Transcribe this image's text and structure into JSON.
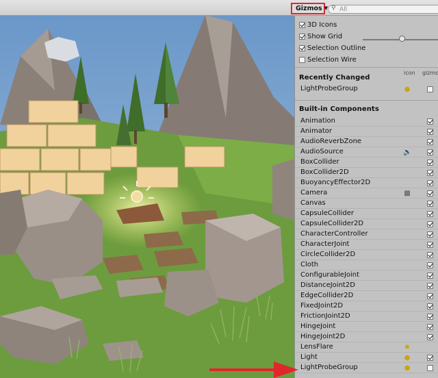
{
  "toolbar": {
    "gizmos_label": "Gizmos",
    "search_placeholder": "All"
  },
  "gizmo_options": [
    {
      "label": "3D Icons",
      "checked": true
    },
    {
      "label": "Show Grid",
      "checked": true
    },
    {
      "label": "Selection Outline",
      "checked": true
    },
    {
      "label": "Selection Wire",
      "checked": false
    }
  ],
  "icon_size_slider": {
    "value": 0.5
  },
  "recently_changed": {
    "title": "Recently Changed",
    "col_icon": "icon",
    "col_gizmo": "gizmo",
    "items": [
      {
        "name": "LightProbeGroup",
        "icon": "light-probe-icon",
        "checked": false
      }
    ]
  },
  "builtin": {
    "title": "Built-in Components",
    "items": [
      {
        "name": "Animation",
        "icon": "",
        "checked": true
      },
      {
        "name": "Animator",
        "icon": "",
        "checked": true
      },
      {
        "name": "AudioReverbZone",
        "icon": "",
        "checked": true
      },
      {
        "name": "AudioSource",
        "icon": "speaker-icon",
        "checked": true
      },
      {
        "name": "BoxCollider",
        "icon": "",
        "checked": true
      },
      {
        "name": "BoxCollider2D",
        "icon": "",
        "checked": true
      },
      {
        "name": "BuoyancyEffector2D",
        "icon": "",
        "checked": true
      },
      {
        "name": "Camera",
        "icon": "camera-icon",
        "checked": true
      },
      {
        "name": "Canvas",
        "icon": "",
        "checked": true
      },
      {
        "name": "CapsuleCollider",
        "icon": "",
        "checked": true
      },
      {
        "name": "CapsuleCollider2D",
        "icon": "",
        "checked": true
      },
      {
        "name": "CharacterController",
        "icon": "",
        "checked": true
      },
      {
        "name": "CharacterJoint",
        "icon": "",
        "checked": true
      },
      {
        "name": "CircleCollider2D",
        "icon": "",
        "checked": true
      },
      {
        "name": "Cloth",
        "icon": "",
        "checked": true
      },
      {
        "name": "ConfigurableJoint",
        "icon": "",
        "checked": true
      },
      {
        "name": "DistanceJoint2D",
        "icon": "",
        "checked": true
      },
      {
        "name": "EdgeCollider2D",
        "icon": "",
        "checked": true
      },
      {
        "name": "FixedJoint2D",
        "icon": "",
        "checked": true
      },
      {
        "name": "FrictionJoint2D",
        "icon": "",
        "checked": true
      },
      {
        "name": "HingeJoint",
        "icon": "",
        "checked": true
      },
      {
        "name": "HingeJoint2D",
        "icon": "",
        "checked": true
      },
      {
        "name": "LensFlare",
        "icon": "lens-flare-icon",
        "checked": null
      },
      {
        "name": "Light",
        "icon": "light-bulb-icon",
        "checked": true
      },
      {
        "name": "LightProbeGroup",
        "icon": "light-probe-icon",
        "checked": false
      }
    ]
  }
}
